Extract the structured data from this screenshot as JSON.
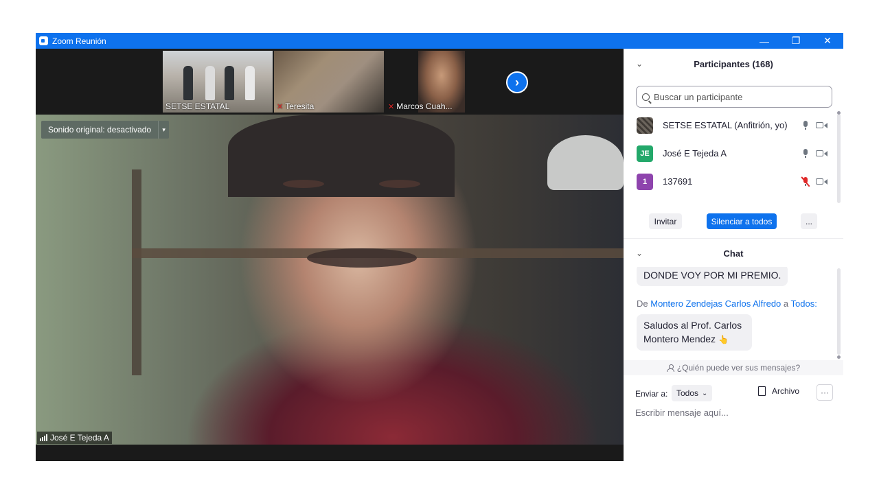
{
  "window": {
    "title": "Zoom Reunión",
    "controls": {
      "minimize": "—",
      "maximize": "❐",
      "close": "✕"
    }
  },
  "gallery": {
    "thumbnails": [
      {
        "name": "SETSE ESTATAL",
        "muted": false
      },
      {
        "name": "Teresita",
        "muted": true
      },
      {
        "name": "Marcos Cuah...",
        "muted": true
      }
    ],
    "next_icon": "›"
  },
  "video": {
    "original_sound_label": "Sonido original: desactivado",
    "original_sound_dropdown": "▾",
    "active_speaker": "José E Tejeda A"
  },
  "participants": {
    "header": "Participantes (168)",
    "collapse_icon": "⌄",
    "search_placeholder": "Buscar un participante",
    "list": [
      {
        "name": "SETSE ESTATAL (Anfitrión, yo)",
        "initials": "",
        "avatar_color": "#5d5750",
        "mic_muted": false
      },
      {
        "name": "José E Tejeda A",
        "initials": "JE",
        "avatar_color": "#23a86a",
        "mic_muted": false
      },
      {
        "name": "137691",
        "initials": "1",
        "avatar_color": "#8e44ad",
        "mic_muted": true
      }
    ],
    "partial_avatar_color": "#f2a81d",
    "invite_label": "Invitar",
    "mute_all_label": "Silenciar a todos",
    "more_label": "..."
  },
  "chat": {
    "header": "Chat",
    "collapse_icon": "⌄",
    "messages": [
      {
        "text": "DONDE VOY POR MI PREMIO."
      },
      {
        "from_prefix": "De ",
        "from": "Montero Zendejas Carlos Alfredo",
        "to_prefix": " a ",
        "to": "Todos:",
        "text_line1": "Saludos al Prof. Carlos",
        "text_line2": "Montero Mendez",
        "emoji": "👆"
      }
    ],
    "who_sees": "¿Quién puede ver sus mensajes?",
    "send_to_label": "Enviar a:",
    "send_to_value": "Todos",
    "send_to_caret": "⌄",
    "file_label": "Archivo",
    "more_label": "···",
    "input_placeholder": "Escribir mensaje aquí..."
  },
  "colors": {
    "accent": "#0e72ed",
    "muted": "#e02828",
    "panel_bg": "#ffffff",
    "video_bg": "#1a1a1a"
  }
}
